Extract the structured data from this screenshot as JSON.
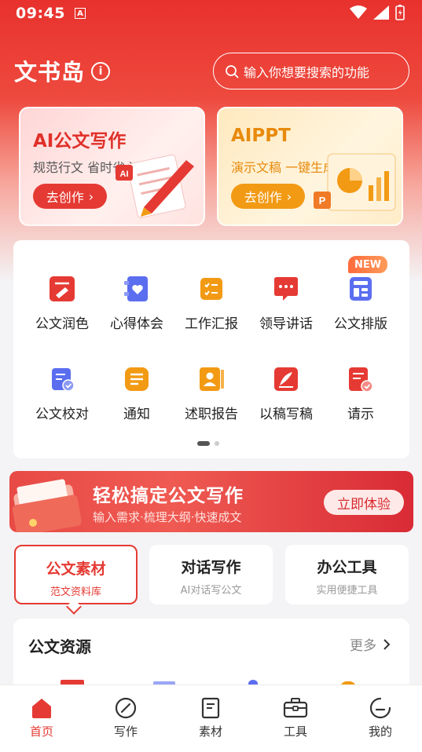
{
  "status_bar": {
    "time": "09:45",
    "app_badge": "A"
  },
  "header": {
    "title": "文书岛",
    "info_icon": "info-icon"
  },
  "search": {
    "placeholder": "输入你想要搜索的功能"
  },
  "feature_cards": [
    {
      "title": "AI公文写作",
      "subtitle": "规范行文 省时省心",
      "button": "去创作",
      "illus_badge": "AI"
    },
    {
      "title": "AIPPT",
      "subtitle": "演示文稿 一键生成",
      "button": "去创作",
      "illus_badge": "P"
    }
  ],
  "grid": {
    "items": [
      {
        "label": "公文润色",
        "icon": "polish-icon",
        "color": "#e53a33"
      },
      {
        "label": "心得体会",
        "icon": "heart-note-icon",
        "color": "#5b6ef0"
      },
      {
        "label": "工作汇报",
        "icon": "checklist-icon",
        "color": "#f29a14"
      },
      {
        "label": "领导讲话",
        "icon": "speech-bubble-icon",
        "color": "#e53a33"
      },
      {
        "label": "公文排版",
        "icon": "layout-icon",
        "color": "#5b6ef0"
      },
      {
        "label": "公文校对",
        "icon": "proofread-icon",
        "color": "#5b6ef0"
      },
      {
        "label": "通知",
        "icon": "notice-icon",
        "color": "#f29a14"
      },
      {
        "label": "述职报告",
        "icon": "person-report-icon",
        "color": "#f29a14"
      },
      {
        "label": "以稿写稿",
        "icon": "pen-draft-icon",
        "color": "#e53a33"
      },
      {
        "label": "请示",
        "icon": "request-doc-icon",
        "color": "#e53a33"
      }
    ],
    "new_badge": "NEW"
  },
  "promo": {
    "title": "轻松搞定公文写作",
    "subtitle": "输入需求·梳理大纲·快速成文",
    "button": "立即体验"
  },
  "tabs": [
    {
      "title": "公文素材",
      "subtitle": "范文资料库",
      "active": true
    },
    {
      "title": "对话写作",
      "subtitle": "AI对话写公文",
      "active": false
    },
    {
      "title": "办公工具",
      "subtitle": "实用便捷工具",
      "active": false
    }
  ],
  "resources": {
    "title": "公文资源",
    "more": "更多"
  },
  "bottom_nav": [
    {
      "label": "首页",
      "icon": "home-icon",
      "active": true
    },
    {
      "label": "写作",
      "icon": "write-icon",
      "active": false
    },
    {
      "label": "素材",
      "icon": "material-icon",
      "active": false
    },
    {
      "label": "工具",
      "icon": "toolbox-icon",
      "active": false
    },
    {
      "label": "我的",
      "icon": "profile-icon",
      "active": false
    }
  ],
  "colors": {
    "brand_red": "#e53a33",
    "accent_orange": "#f29a14",
    "accent_blue": "#5b6ef0"
  }
}
